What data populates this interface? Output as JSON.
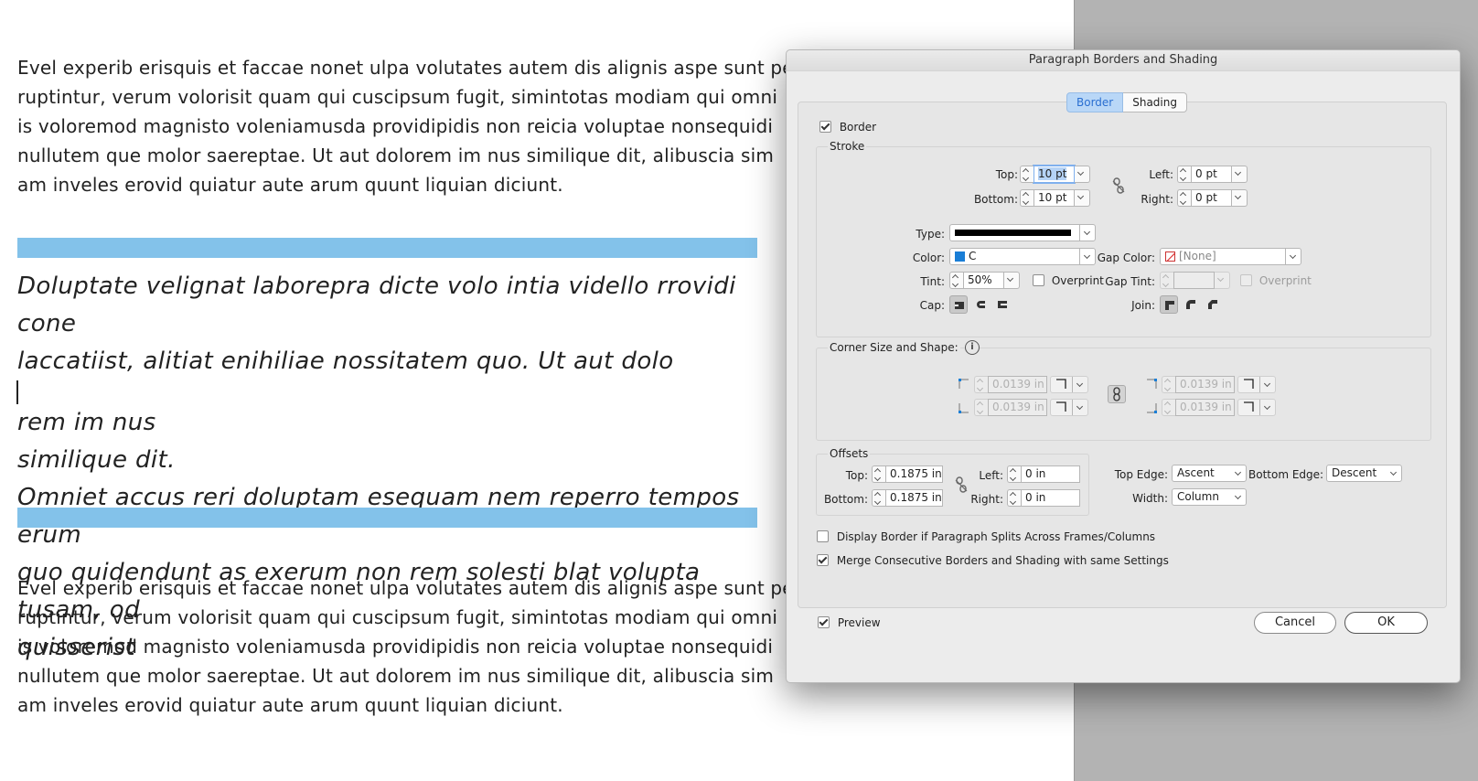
{
  "document": {
    "para1": [
      "Evel experib erisquis et faccae nonet ulpa volutates autem dis alignis aspe sunt pe-",
      "ruptintur, verum volorisit quam qui cuscipsum fugit, simintotas modiam qui omni",
      "is voloremod magnisto voleniamusda providipidis non reicia voluptae nonsequidi",
      "nullutem que molor saereptae. Ut aut dolorem im nus similique dit, alibuscia sim",
      "am inveles erovid quiatur aute arum quunt liquian diciunt."
    ],
    "italic": {
      "line1": "Doluptate velignat laborepra dicte volo intia vidello rrovidi cone",
      "line2a": "laccatiist, alitiat enihiliae nossitatem quo. Ut aut dolo",
      "line2b": "rem im nus",
      "line3": "similique dit.",
      "line4": "Omniet accus reri doluptam esequam nem reperro tempos erum",
      "line5": "quo quidendunt as exerum non rem solesti blat volupta tusam, od",
      "line6": "quisserist"
    },
    "para2": [
      "Evel experib erisquis et faccae nonet ulpa volutates autem dis alignis aspe sunt pe-",
      "ruptintur, verum volorisit quam qui cuscipsum fugit, simintotas modiam qui omni",
      "is voloremod magnisto voleniamusda providipidis non reicia voluptae nonsequidi",
      "nullutem que molor saereptae. Ut aut dolorem im nus similique dit, alibuscia sim",
      "am inveles erovid quiatur aute arum quunt liquian diciunt."
    ],
    "rule_color": "#83c2ea"
  },
  "dialog": {
    "title": "Paragraph Borders and Shading",
    "tabs": {
      "border": "Border",
      "shading": "Shading"
    },
    "border_checkbox": "Border",
    "stroke": {
      "title": "Stroke",
      "top_label": "Top:",
      "top_value": "10 pt",
      "bottom_label": "Bottom:",
      "bottom_value": "10 pt",
      "left_label": "Left:",
      "left_value": "0 pt",
      "right_label": "Right:",
      "right_value": "0 pt",
      "type_label": "Type:",
      "color_label": "Color:",
      "color_value": "C",
      "color_swatch": "#1a7ed6",
      "tint_label": "Tint:",
      "tint_value": "50%",
      "overprint_label": "Overprint",
      "cap_label": "Cap:",
      "gap_color_label": "Gap Color:",
      "gap_color_value": "[None]",
      "gap_tint_label": "Gap Tint:",
      "gap_overprint_label": "Overprint",
      "join_label": "Join:"
    },
    "corner": {
      "title": "Corner Size and Shape:",
      "tl": "0.0139 in",
      "bl": "0.0139 in",
      "tr": "0.0139 in",
      "br": "0.0139 in"
    },
    "offsets": {
      "title": "Offsets",
      "top_label": "Top:",
      "top_value": "0.1875 in",
      "bottom_label": "Bottom:",
      "bottom_value": "0.1875 in",
      "left_label": "Left:",
      "left_value": "0 in",
      "right_label": "Right:",
      "right_value": "0 in",
      "top_edge_label": "Top Edge:",
      "top_edge_value": "Ascent",
      "bottom_edge_label": "Bottom Edge:",
      "bottom_edge_value": "Descent",
      "width_label": "Width:",
      "width_value": "Column"
    },
    "display_border_label": "Display Border if Paragraph Splits Across Frames/Columns",
    "merge_label": "Merge Consecutive Borders and Shading with same Settings",
    "preview_label": "Preview",
    "cancel_label": "Cancel",
    "ok_label": "OK"
  }
}
